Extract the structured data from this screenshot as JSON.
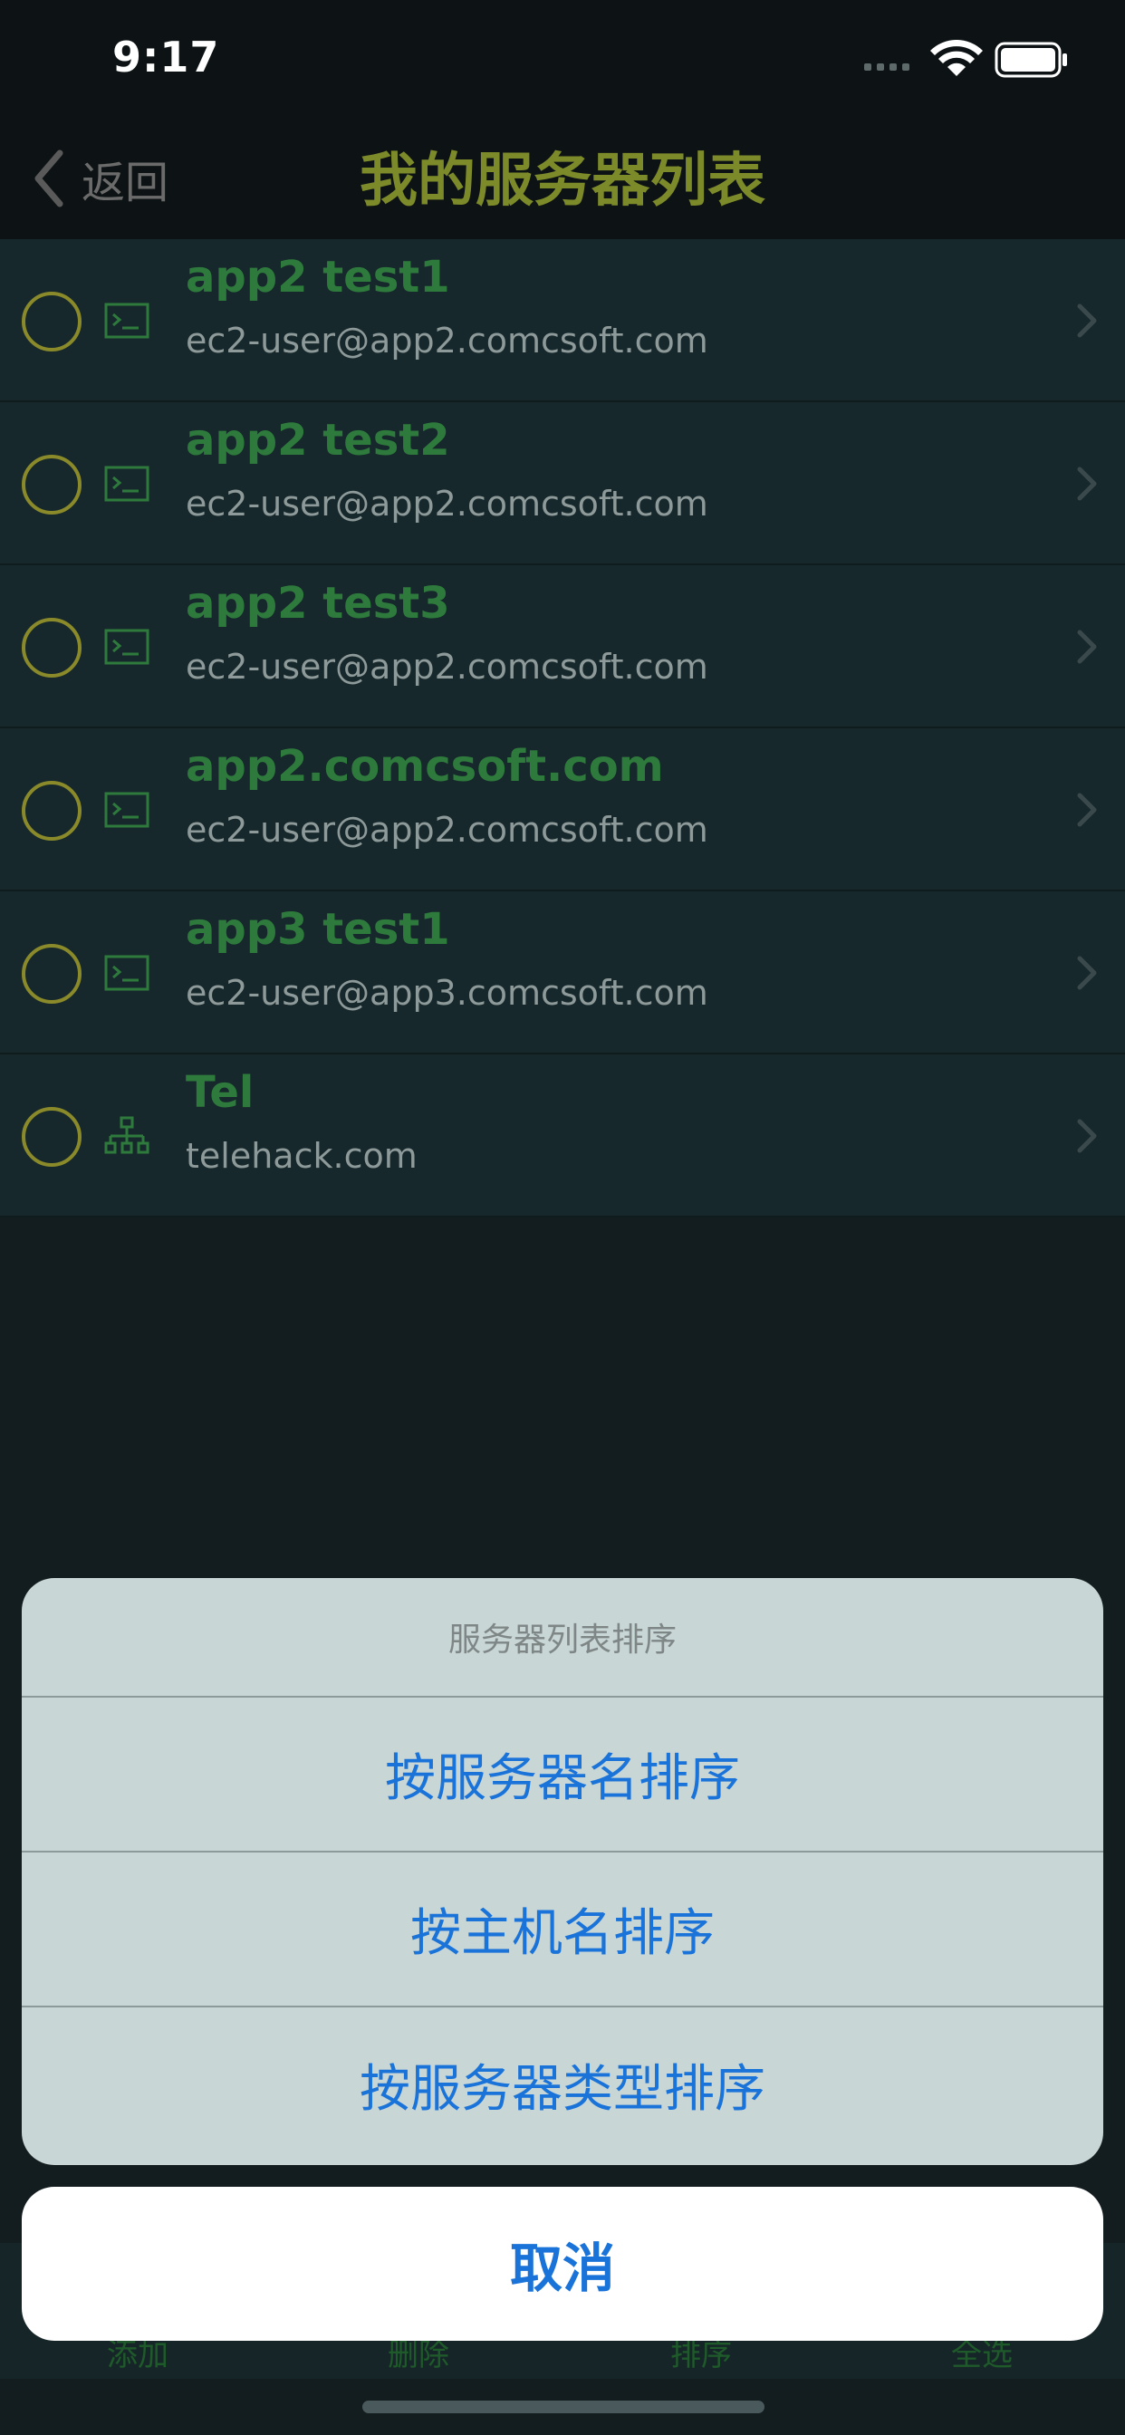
{
  "status_bar": {
    "time": "9:17"
  },
  "nav": {
    "back_label": "返回",
    "title": "我的服务器列表"
  },
  "servers": [
    {
      "name": "app2 test1",
      "host": "ec2-user@app2.comcsoft.com",
      "icon": "terminal-icon"
    },
    {
      "name": "app2 test2",
      "host": "ec2-user@app2.comcsoft.com",
      "icon": "terminal-icon"
    },
    {
      "name": "app2 test3",
      "host": "ec2-user@app2.comcsoft.com",
      "icon": "terminal-icon"
    },
    {
      "name": "app2.comcsoft.com",
      "host": "ec2-user@app2.comcsoft.com",
      "icon": "terminal-icon"
    },
    {
      "name": "app3 test1",
      "host": "ec2-user@app3.comcsoft.com",
      "icon": "terminal-icon"
    },
    {
      "name": "Tel",
      "host": "telehack.com",
      "icon": "network-icon"
    }
  ],
  "toolbar": {
    "add": "添加",
    "delete": "删除",
    "sort": "排序",
    "select_all": "全选"
  },
  "action_sheet": {
    "title": "服务器列表排序",
    "options": [
      "按服务器名排序",
      "按主机名排序",
      "按服务器类型排序"
    ],
    "cancel": "取消"
  },
  "colors": {
    "title": "#7d8a2a",
    "server_name": "#2e7a3c",
    "host": "#8e9a9a",
    "action": "#1a73d9",
    "sheet_bg": "#c9d6d6"
  }
}
